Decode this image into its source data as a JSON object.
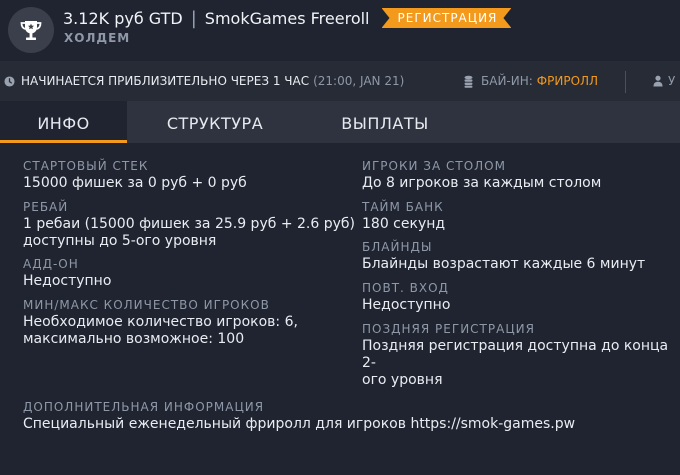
{
  "header": {
    "prize": "3.12K руб GTD",
    "separator": "|",
    "name": "SmokGames Freeroll",
    "badge": "РЕГИСТРАЦИЯ",
    "subtitle": "ХОЛДЕМ",
    "icon": "trophy-icon"
  },
  "infobar": {
    "start_text": "НАЧИНАЕТСЯ ПРИБЛИЗИТЕЛЬНО ЧЕРЕЗ 1 ЧАС",
    "start_time": "(21:00, JAN 21)",
    "buyin_label": "БАЙ-ИН:",
    "buyin_value": "ФРИРОЛЛ",
    "cut_label": "У"
  },
  "tabs": [
    {
      "label": "ИНФО",
      "active": true
    },
    {
      "label": "СТРУКТУРА",
      "active": false
    },
    {
      "label": "ВЫПЛАТЫ",
      "active": false
    }
  ],
  "fields": {
    "starting_stack": {
      "label": "СТАРТОВЫЙ СТЕК",
      "value": "15000 фишек за 0 руб + 0 руб"
    },
    "rebuy": {
      "label": "РЕБАЙ",
      "value_line1": "1 ребаи (15000 фишек за 25.9 руб + 2.6 руб)",
      "value_line2": "доступны до 5-ого уровня"
    },
    "addon": {
      "label": "АДД-ОН",
      "value": "Недоступно"
    },
    "min_max": {
      "label": "МИН/МАКС КОЛИЧЕСТВО ИГРОКОВ",
      "value_line1": "Необходимое количество игроков: 6,",
      "value_line2": "максимально возможное: 100"
    },
    "players_at_table": {
      "label": "ИГРОКИ ЗА СТОЛОМ",
      "value": "До 8 игроков за каждым столом"
    },
    "time_bank": {
      "label": "ТАЙМ БАНК",
      "value": "180 секунд"
    },
    "blinds": {
      "label": "БЛАЙНДЫ",
      "value": "Блайнды возрастают каждые 6 минут"
    },
    "reentry": {
      "label": "ПОВТ. ВХОД",
      "value": "Недоступно"
    },
    "late_reg": {
      "label": "ПОЗДНЯЯ РЕГИСТРАЦИЯ",
      "value_line1": "Поздняя регистрация доступна до конца 2-",
      "value_line2": "ого уровня"
    },
    "additional": {
      "label": "ДОПОЛНИТЕЛЬНАЯ ИНФОРМАЦИЯ",
      "value": "Специальный еженедельный фриролл для игроков https://smok-games.pw"
    }
  },
  "colors": {
    "accent": "#f39a1c",
    "background": "#1f2430",
    "bar": "#262b36",
    "tabs": "#2e333f",
    "label": "#8f98a7"
  }
}
